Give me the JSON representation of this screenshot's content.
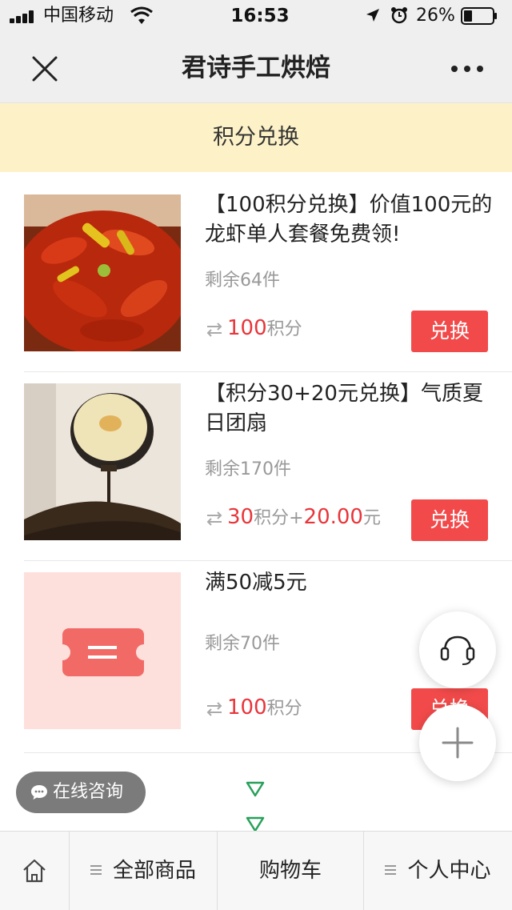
{
  "status_bar": {
    "carrier": "中国移动",
    "time": "16:53",
    "battery": "26%"
  },
  "navbar": {
    "title": "君诗手工烘焙",
    "close_icon": "close-icon",
    "more_icon": "more-icon"
  },
  "section": {
    "title": "积分兑换"
  },
  "products": [
    {
      "title": "【100积分兑换】价值100元的龙虾单人套餐免费领!",
      "stock": "剩余64件",
      "points": "100",
      "points_unit": "积分",
      "button": "兑换"
    },
    {
      "title": "【积分30+20元兑换】气质夏日团扇",
      "stock": "剩余170件",
      "points": "30",
      "points_unit": "积分+",
      "cash": "20.00",
      "cash_unit": "元",
      "button": "兑换"
    },
    {
      "title": "满50减5元",
      "stock": "剩余70件",
      "points": "100",
      "points_unit": "积分",
      "button": "兑换"
    }
  ],
  "floating": {
    "chat_label": "在线咨询",
    "headset_icon": "headset-icon",
    "plus_icon": "plus-icon"
  },
  "tabbar": {
    "home_icon": "home-icon",
    "all_products": "全部商品",
    "cart": "购物车",
    "profile": "个人中心"
  },
  "colors": {
    "accent": "#f24a4a",
    "price": "#e8353a",
    "banner": "#fdf2c7"
  }
}
